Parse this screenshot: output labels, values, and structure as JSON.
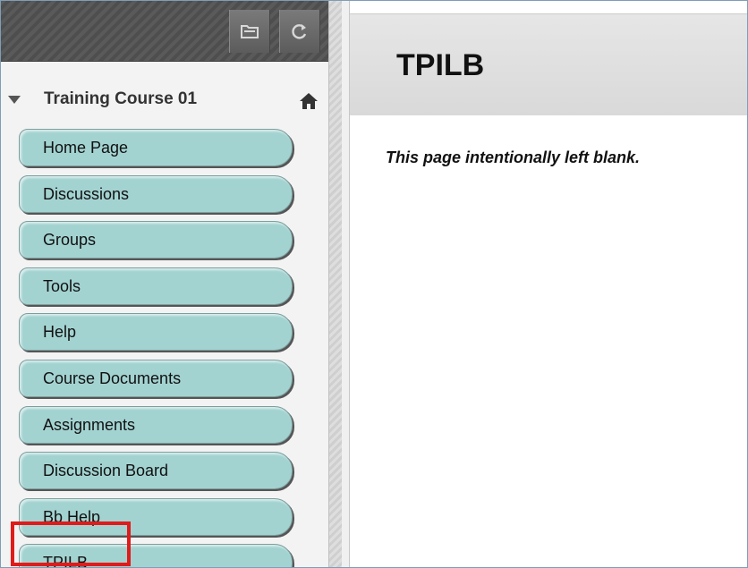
{
  "sidebar": {
    "course_title": "Training Course 01",
    "items": [
      {
        "label": "Home Page"
      },
      {
        "label": "Discussions"
      },
      {
        "label": "Groups"
      },
      {
        "label": "Tools"
      },
      {
        "label": "Help"
      },
      {
        "label": "Course Documents"
      },
      {
        "label": "Assignments"
      },
      {
        "label": "Discussion Board"
      },
      {
        "label": "Bb Help"
      },
      {
        "label": "TPILB"
      }
    ],
    "highlighted_item": "TPILB",
    "icons": [
      "folder-view-icon",
      "refresh-icon",
      "collapse-arrow-icon",
      "home-icon"
    ]
  },
  "content": {
    "title": "TPILB",
    "body_text": "This page intentionally left blank."
  },
  "colors": {
    "menu_button": "#a3d3d1",
    "highlight": "#e01b1b",
    "header_bar": "#4e4e4e"
  }
}
